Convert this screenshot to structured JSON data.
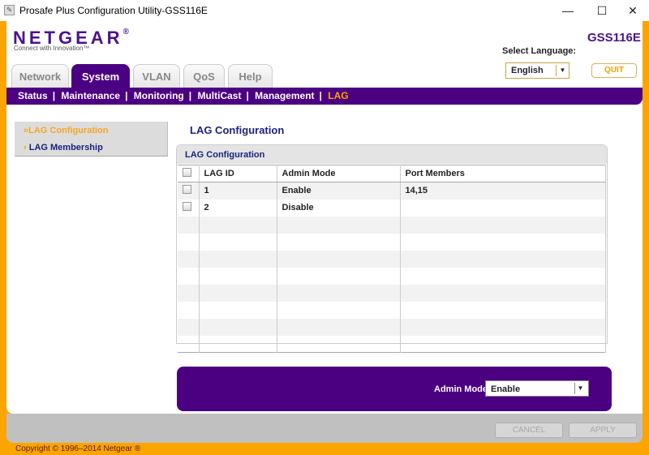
{
  "window": {
    "title": "Prosafe Plus Configuration Utility-GSS116E",
    "minimize": "—",
    "maximize": "☐",
    "close": "✕"
  },
  "header": {
    "logo": "NETGEAR",
    "logo_mark": "®",
    "tagline": "Connect with Innovation™",
    "model": "GSS116E",
    "language_label": "Select Language:",
    "language": "English",
    "quit": "QUIT"
  },
  "tabs": [
    {
      "label": "Network"
    },
    {
      "label": "System"
    },
    {
      "label": "VLAN"
    },
    {
      "label": "QoS"
    },
    {
      "label": "Help"
    }
  ],
  "subnav": [
    "Status",
    "Maintenance",
    "Monitoring",
    "MultiCast",
    "Management",
    "LAG"
  ],
  "sidebar": [
    {
      "label": "LAG Configuration",
      "marker": "»"
    },
    {
      "label": "LAG Membership",
      "marker": "›"
    }
  ],
  "page_title": "LAG Configuration",
  "panel": {
    "title": "LAG Configuration",
    "columns": [
      "LAG ID",
      "Admin Mode",
      "Port Members"
    ],
    "rows": [
      {
        "id": "1",
        "mode": "Enable",
        "members": "14,15"
      },
      {
        "id": "2",
        "mode": "Disable",
        "members": ""
      }
    ]
  },
  "admin_mode": {
    "label": "Admin Mode",
    "value": "Enable"
  },
  "footer": {
    "cancel": "CANCEL",
    "apply": "APPLY",
    "copyright": "Copyright © 1996–2014 Netgear ®"
  },
  "colors": {
    "brand_purple": "#4b0082",
    "accent_orange": "#fca400"
  }
}
